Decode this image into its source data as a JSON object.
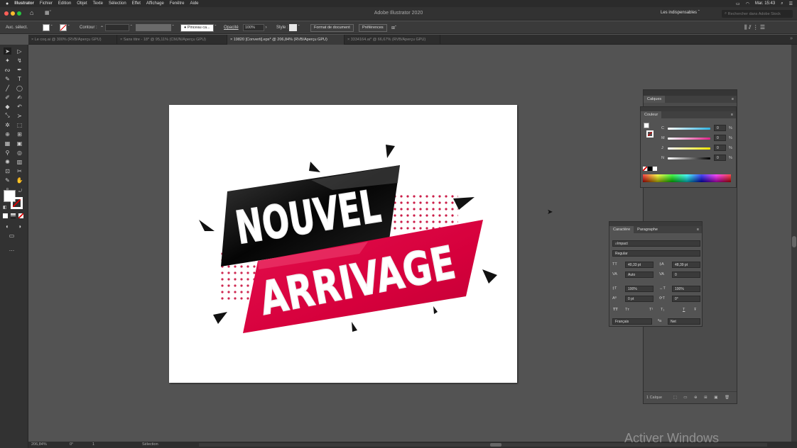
{
  "menubar": {
    "items": [
      "Illustrator",
      "Fichier",
      "Edition",
      "Objet",
      "Texte",
      "Sélection",
      "Effet",
      "Affichage",
      "Fenêtre",
      "Aide"
    ],
    "clock": "Mar. 15:43"
  },
  "window": {
    "title": "Adobe Illustrator 2020",
    "workspace": "Les indispensables",
    "search_placeholder": "Rechercher dans Adobe Stock"
  },
  "controlbar": {
    "selection_label": "Auc. sélect.",
    "stroke_label": "Contour :",
    "brush_label": "Pinceau ca...",
    "opacity_label": "Opacité",
    "opacity_value": "100%",
    "style_label": "Style :",
    "doc_format_button": "Format de document",
    "preferences_button": "Préférences"
  },
  "tabs": [
    {
      "label": "Le coq.ai @ 300% (RVB/Aperçu GPU)",
      "active": false
    },
    {
      "label": "Sans titre - 18* @ 95,11% (CMJN/Aperçu GPU)",
      "active": false
    },
    {
      "label": "19820 [Converti].eps* @ 206,84% (RVB/Aperçu GPU)",
      "active": true
    },
    {
      "label": "3334164.ai* @ 66,67% (RVB/Aperçu GPU)",
      "active": false
    }
  ],
  "artwork": {
    "line1": "NOUVEL",
    "line2": "ARRIVAGE",
    "colors": {
      "black_band": "#111111",
      "red_band": "#d6003c",
      "dots": "#c8103e"
    }
  },
  "layers_panel": {
    "title": "Calques",
    "footer": "1 Calque"
  },
  "color_panel": {
    "title": "Couleur",
    "channels": [
      {
        "label": "C",
        "value": "0",
        "unit": "%",
        "color": "#2fb4e4"
      },
      {
        "label": "M",
        "value": "0",
        "unit": "%",
        "color": "#e0218a"
      },
      {
        "label": "J",
        "value": "0",
        "unit": "%",
        "color": "#f2e500"
      },
      {
        "label": "N",
        "value": "0",
        "unit": "%",
        "color": "#888888"
      }
    ]
  },
  "character_panel": {
    "tabs": [
      "Caractère",
      "Paragraphe"
    ],
    "font_family": "Impact",
    "font_style": "Regular",
    "font_size": "40,33 pt",
    "leading": "48,39 pt",
    "kerning": "Auto",
    "tracking": "0",
    "vscale": "100%",
    "hscale": "100%",
    "baseline": "0 pt",
    "rotation": "0°",
    "style_buttons": [
      "TT",
      "Tт",
      "T¹",
      "T₁",
      "T",
      "Ŧ"
    ],
    "language": "Français",
    "antialias": "Net"
  },
  "statusbar": {
    "zoom": "206,84%",
    "rotation": "0°",
    "artboard": "1",
    "tool": "Sélection"
  },
  "watermark": "Activer Windows"
}
